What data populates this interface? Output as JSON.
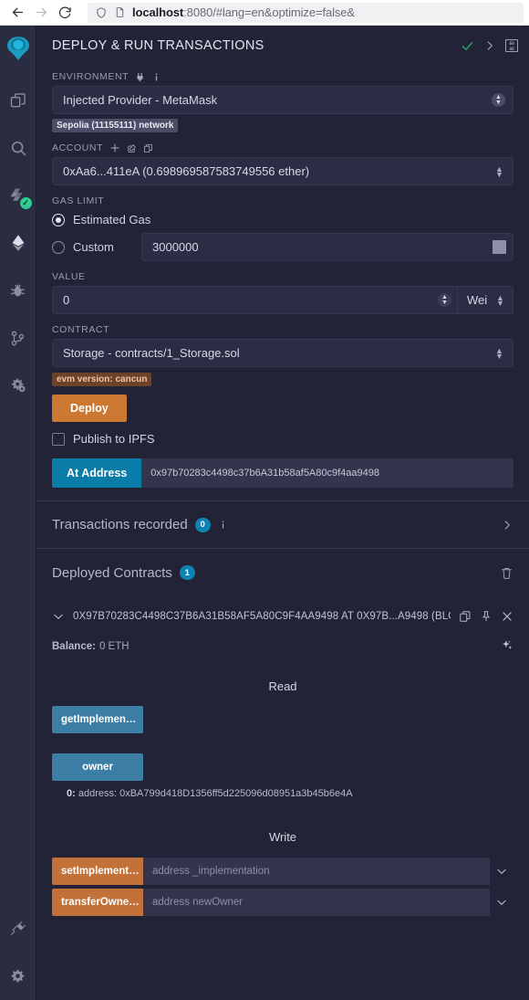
{
  "browser": {
    "back_icon": "arrow-left-icon",
    "forward_icon": "arrow-right-icon",
    "reload_icon": "reload-icon",
    "shield_icon": "shield-icon",
    "page_icon": "page-icon",
    "url_host": "localhost",
    "url_rest": ":8080/#lang=en&optimize=false&"
  },
  "rail": {
    "logo": "remix-logo-icon",
    "items": [
      {
        "name": "file-explorer-icon"
      },
      {
        "name": "search-icon"
      },
      {
        "name": "solidity-compiler-icon",
        "status": "✓"
      },
      {
        "name": "deploy-run-transactions-icon"
      },
      {
        "name": "debugger-icon"
      },
      {
        "name": "git-icon"
      },
      {
        "name": "remix-guide-icon"
      }
    ],
    "bottom": [
      {
        "name": "plugin-manager-icon"
      },
      {
        "name": "settings-icon"
      }
    ]
  },
  "header": {
    "title": "DEPLOY & RUN TRANSACTIONS",
    "check_icon": "check-icon",
    "chevron_icon": "chevron-right-icon",
    "charcode_icon": "character-code-icon",
    "charcode_top": "E0",
    "charcode_bottom": "06"
  },
  "environment": {
    "label": "ENVIRONMENT",
    "plug_icon": "plug-icon",
    "info_icon": "info-icon",
    "value": "Injected Provider - MetaMask",
    "network_badge": "Sepolia (11155111) network"
  },
  "account": {
    "label": "ACCOUNT",
    "add_icon": "plus-icon",
    "edit_icon": "edit-icon",
    "copy_icon": "copy-icon",
    "value": "0xAa6...411eA (0.698969587583749556 ether)"
  },
  "gas_limit": {
    "label": "GAS LIMIT",
    "estimated_label": "Estimated Gas",
    "custom_label": "Custom",
    "custom_value": "3000000",
    "selected": "estimated"
  },
  "value_field": {
    "label": "VALUE",
    "value": "0",
    "unit": "Wei"
  },
  "contract": {
    "label": "CONTRACT",
    "value": "Storage - contracts/1_Storage.sol",
    "evm_badge": "evm version: cancun",
    "deploy_label": "Deploy",
    "publish_label": "Publish to IPFS",
    "at_address_label": "At Address",
    "at_address_value": "0x97b70283c4498c37b6A31b58af5A80c9f4aa9498"
  },
  "transactions": {
    "label": "Transactions recorded",
    "count": "0",
    "info_icon": "info-icon",
    "chevron_icon": "chevron-right-icon"
  },
  "deployed": {
    "label": "Deployed Contracts",
    "count": "1",
    "trash_icon": "trash-icon",
    "card": {
      "caret_icon": "chevron-down-icon",
      "title": "0X97B70283C4498C37B6A31B58AF5A80C9F4AA9498 AT 0X97B...A9498 (BLO",
      "copy_icon": "copy-icon",
      "pin_icon": "pin-icon",
      "close_icon": "close-icon",
      "balance_label": "Balance:",
      "balance_value": "0 ETH",
      "ai_icon": "sparkles-icon"
    },
    "read_title": "Read",
    "read_functions": [
      {
        "label": "getImplemen…",
        "result": null
      },
      {
        "label": "owner",
        "result_index": "0:",
        "result": "address: 0xBA799d418D1356ff5d225096d08951a3b45b6e4A"
      }
    ],
    "write_title": "Write",
    "write_functions": [
      {
        "label": "setImplement…",
        "placeholder": "address _implementation",
        "caret_icon": "chevron-down-icon"
      },
      {
        "label": "transferOwne…",
        "placeholder": "address newOwner",
        "caret_icon": "chevron-down-icon"
      }
    ]
  },
  "colors": {
    "accent_orange": "#cc7832",
    "accent_blue": "#0a7ca8",
    "read_blue": "#3d7ea6",
    "write_orange": "#c27138",
    "panel_bg": "#222336",
    "rail_bg": "#2a2c42",
    "badge_blue": "#0d82b4",
    "success_green": "#26a269"
  }
}
